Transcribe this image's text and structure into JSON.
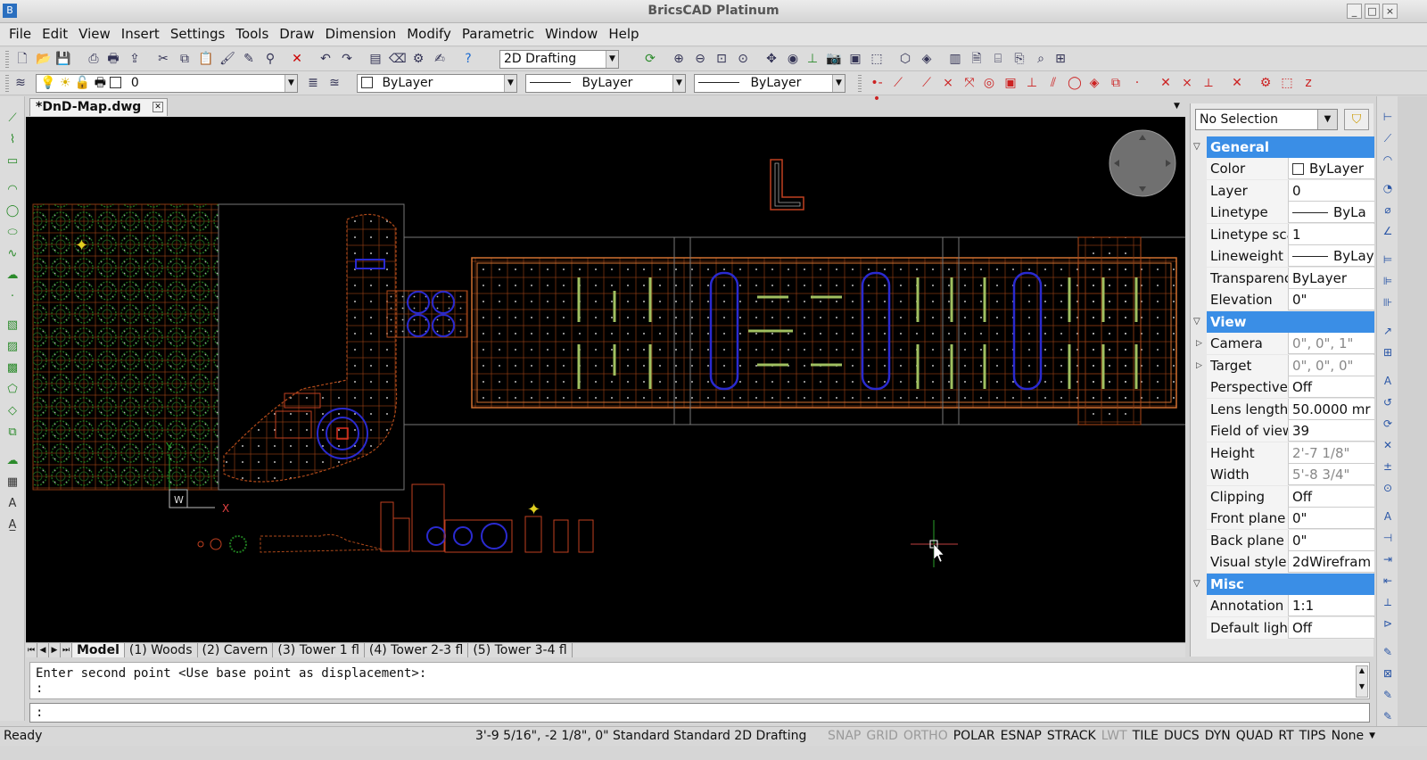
{
  "app": {
    "title": "BricsCAD Platinum"
  },
  "menu": [
    "File",
    "Edit",
    "View",
    "Insert",
    "Settings",
    "Tools",
    "Draw",
    "Dimension",
    "Modify",
    "Parametric",
    "Window",
    "Help"
  ],
  "toolbar": {
    "workspace": "2D Drafting",
    "layer": "0",
    "color": "ByLayer",
    "linetype": "ByLayer",
    "lineweight": "ByLayer"
  },
  "document": {
    "tab_title": "*DnD-Map.dwg"
  },
  "layout_tabs": [
    "Model",
    "(1) Woods",
    "(2) Cavern",
    "(3) Tower 1 fl",
    "(4) Tower 2-3 fl",
    "(5) Tower 3-4 fl"
  ],
  "canvas": {
    "ucs_x": "X",
    "ucs_y": "Y",
    "ucs_w": "W"
  },
  "command": {
    "history_line1": "Enter second point <Use base point as displacement>:",
    "history_line2": ":",
    "prompt": ":"
  },
  "properties": {
    "selection": "No Selection",
    "sections": {
      "general": "General",
      "view": "View",
      "misc": "Misc"
    },
    "general_rows": [
      {
        "name": "Color",
        "value": "ByLayer"
      },
      {
        "name": "Layer",
        "value": "0"
      },
      {
        "name": "Linetype",
        "value": "ByLa"
      },
      {
        "name": "Linetype sca",
        "value": "1"
      },
      {
        "name": "Lineweight",
        "value": "ByLay"
      },
      {
        "name": "Transparenc",
        "value": "ByLayer"
      },
      {
        "name": "Elevation",
        "value": "0\""
      }
    ],
    "view_rows": [
      {
        "name": "Camera",
        "value": "0\", 0\", 1\""
      },
      {
        "name": "Target",
        "value": "0\", 0\", 0\""
      },
      {
        "name": "Perspective",
        "value": "Off"
      },
      {
        "name": "Lens length",
        "value": "50.0000 mr"
      },
      {
        "name": "Field of view",
        "value": "39"
      },
      {
        "name": "Height",
        "value": "2'-7 1/8\""
      },
      {
        "name": "Width",
        "value": "5'-8 3/4\""
      },
      {
        "name": "Clipping",
        "value": "Off"
      },
      {
        "name": "Front plane",
        "value": "0\""
      },
      {
        "name": "Back plane",
        "value": "0\""
      },
      {
        "name": "Visual style",
        "value": "2dWirefram"
      }
    ],
    "misc_rows": [
      {
        "name": "Annotation s",
        "value": "1:1"
      },
      {
        "name": "Default lighti",
        "value": "Off"
      }
    ]
  },
  "status": {
    "ready": "Ready",
    "coords": "3'-9 5/16\", -2 1/8\", 0\"  Standard  Standard  2D Drafting",
    "toggles": [
      {
        "label": "SNAP",
        "state": "off"
      },
      {
        "label": "GRID",
        "state": "off"
      },
      {
        "label": "ORTHO",
        "state": "off"
      },
      {
        "label": "POLAR",
        "state": "on"
      },
      {
        "label": "ESNAP",
        "state": "on"
      },
      {
        "label": "STRACK",
        "state": "on"
      },
      {
        "label": "LWT",
        "state": "off"
      },
      {
        "label": "TILE",
        "state": "on"
      },
      {
        "label": "DUCS",
        "state": "on"
      },
      {
        "label": "DYN",
        "state": "on"
      },
      {
        "label": "QUAD",
        "state": "on"
      },
      {
        "label": "RT",
        "state": "on"
      },
      {
        "label": "TIPS",
        "state": "on"
      },
      {
        "label": "None",
        "state": "on"
      }
    ]
  },
  "colors": {
    "accent": "#3a8ee6",
    "canvas_bg": "#000000",
    "drawing_orange": "#b04a1a",
    "drawing_green": "#1a7a1a",
    "drawing_blue": "#2a2ad0"
  }
}
